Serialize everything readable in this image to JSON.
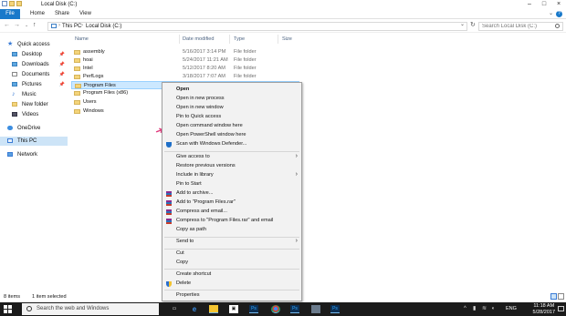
{
  "window": {
    "title": "Local Disk (C:)"
  },
  "ribbon": {
    "tabs": [
      "File",
      "Home",
      "Share",
      "View"
    ]
  },
  "address": {
    "crumbs": [
      "This PC",
      "Local Disk (C:)"
    ],
    "search_placeholder": "Search Local Disk (C:)"
  },
  "nav": {
    "items": [
      {
        "label": "Quick access",
        "icon": "star-icon"
      },
      {
        "label": "Desktop",
        "icon": "folder-icon",
        "pinned": true
      },
      {
        "label": "Downloads",
        "icon": "download-icon",
        "pinned": true
      },
      {
        "label": "Documents",
        "icon": "documents-icon",
        "pinned": true
      },
      {
        "label": "Pictures",
        "icon": "pictures-icon",
        "pinned": true
      },
      {
        "label": "Music",
        "icon": "music-icon"
      },
      {
        "label": "New folder",
        "icon": "folder-icon"
      },
      {
        "label": "Videos",
        "icon": "videos-icon"
      },
      {
        "label": "OneDrive",
        "icon": "onedrive-icon"
      },
      {
        "label": "This PC",
        "icon": "pc-icon",
        "selected": true
      },
      {
        "label": "Network",
        "icon": "network-icon"
      }
    ]
  },
  "columns": [
    "Name",
    "Date modified",
    "Type",
    "Size"
  ],
  "files": [
    {
      "name": "assembly",
      "date": "5/16/2017 3:14 PM",
      "type": "File folder"
    },
    {
      "name": "hoai",
      "date": "5/24/2017 11:21 AM",
      "type": "File folder"
    },
    {
      "name": "Intel",
      "date": "5/12/2017 8:20 AM",
      "type": "File folder"
    },
    {
      "name": "PerfLogs",
      "date": "3/18/2017 7:07 AM",
      "type": "File folder"
    },
    {
      "name": "Program Files",
      "date": "",
      "type": "",
      "selected": true
    },
    {
      "name": "Program Files (x86)",
      "date": "",
      "type": ""
    },
    {
      "name": "Users",
      "date": "",
      "type": ""
    },
    {
      "name": "Windows",
      "date": "",
      "type": ""
    }
  ],
  "context_menu": {
    "items": [
      {
        "label": "Open",
        "bold": true
      },
      {
        "label": "Open in new process"
      },
      {
        "label": "Open in new window"
      },
      {
        "label": "Pin to Quick access"
      },
      {
        "label": "Open command window here"
      },
      {
        "label": "Open PowerShell window here"
      },
      {
        "label": "Scan with Windows Defender...",
        "icon": "defender-icon"
      },
      {
        "sep": true
      },
      {
        "label": "Give access to",
        "submenu": true
      },
      {
        "label": "Restore previous versions"
      },
      {
        "label": "Include in library",
        "submenu": true
      },
      {
        "label": "Pin to Start"
      },
      {
        "label": "Add to archive...",
        "icon": "winrar-icon"
      },
      {
        "label": "Add to \"Program Files.rar\"",
        "icon": "winrar-icon"
      },
      {
        "label": "Compress and email...",
        "icon": "winrar-icon"
      },
      {
        "label": "Compress to \"Program Files.rar\" and email",
        "icon": "winrar-icon"
      },
      {
        "label": "Copy as path"
      },
      {
        "sep": true
      },
      {
        "label": "Send to",
        "submenu": true
      },
      {
        "sep": true
      },
      {
        "label": "Cut"
      },
      {
        "label": "Copy"
      },
      {
        "sep": true
      },
      {
        "label": "Create shortcut"
      },
      {
        "label": "Delete",
        "icon": "shield-icon"
      },
      {
        "sep": true
      },
      {
        "label": "Properties"
      }
    ]
  },
  "status": {
    "count": "8 items",
    "selection": "1 item selected"
  },
  "taskbar": {
    "search_text": "Search the web and Windows",
    "language": "ENG",
    "time": "11:18 AM",
    "date": "5/28/2017",
    "apps": [
      "task-view-icon",
      "edge-icon",
      "file-explorer-icon",
      "store-icon",
      "photoshop-icon",
      "photoshop-icon",
      "chrome-icon",
      "photoshop-icon",
      "app-icon",
      "app-icon"
    ]
  },
  "colors": {
    "accent": "#1979ca",
    "selection": "#cce8ff",
    "arrow": "#e0357a"
  }
}
